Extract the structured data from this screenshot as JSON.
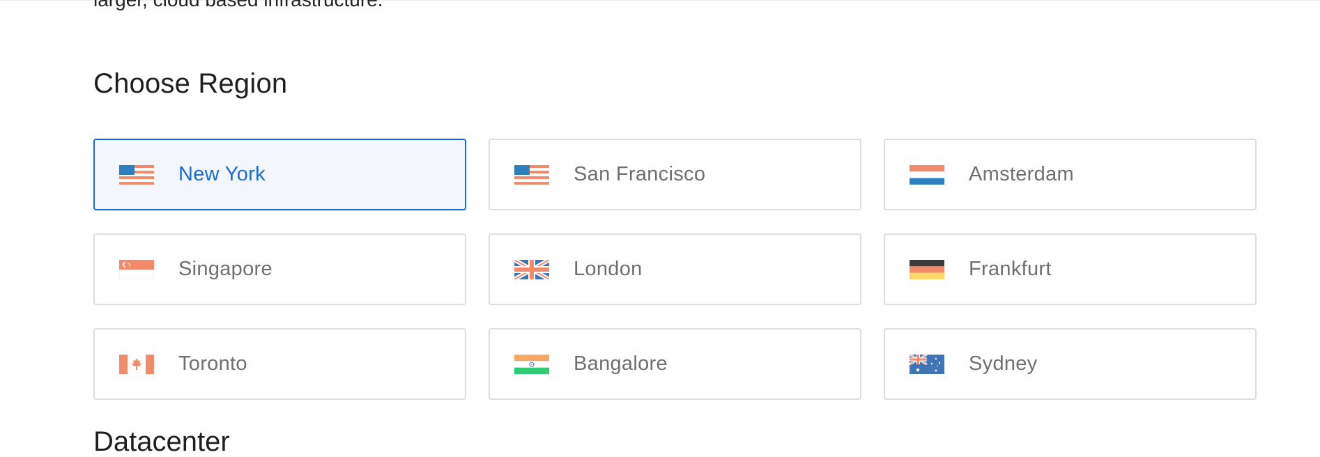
{
  "intro": {
    "text": "larger, cloud based infrastructure."
  },
  "section": {
    "title": "Choose Region"
  },
  "next_section": {
    "title": "Datacenter"
  },
  "colors": {
    "selected_accent": "#1a6ad4",
    "selected_background": "#f3f7fd",
    "card_border": "#dedede",
    "label_text": "#6f6f6f"
  },
  "regions": [
    {
      "label": "New York",
      "flag": "us-flag-icon",
      "selected": true
    },
    {
      "label": "San Francisco",
      "flag": "us-flag-icon",
      "selected": false
    },
    {
      "label": "Amsterdam",
      "flag": "netherlands-flag-icon",
      "selected": false
    },
    {
      "label": "Singapore",
      "flag": "singapore-flag-icon",
      "selected": false
    },
    {
      "label": "London",
      "flag": "uk-flag-icon",
      "selected": false
    },
    {
      "label": "Frankfurt",
      "flag": "germany-flag-icon",
      "selected": false
    },
    {
      "label": "Toronto",
      "flag": "canada-flag-icon",
      "selected": false
    },
    {
      "label": "Bangalore",
      "flag": "india-flag-icon",
      "selected": false
    },
    {
      "label": "Sydney",
      "flag": "australia-flag-icon",
      "selected": false
    }
  ]
}
